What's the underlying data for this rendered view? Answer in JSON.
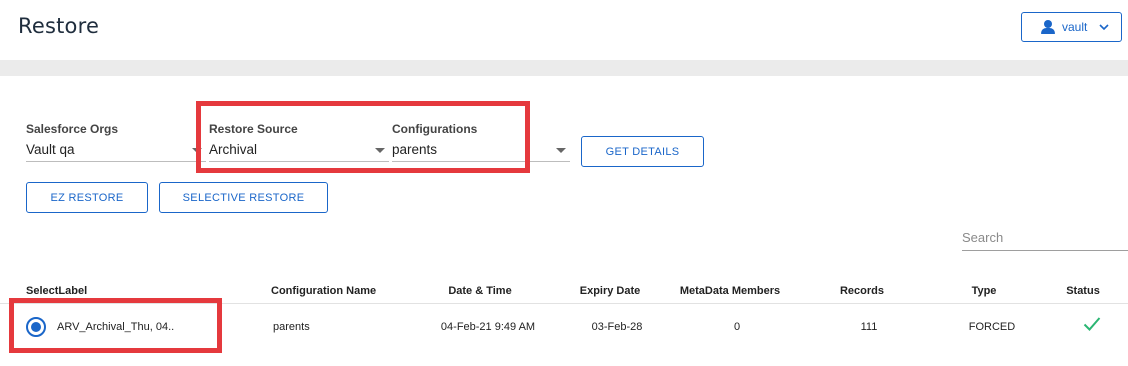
{
  "header": {
    "title": "Restore",
    "user_label": "vault"
  },
  "filters": {
    "orgs": {
      "label": "Salesforce Orgs",
      "value": "Vault qa"
    },
    "source": {
      "label": "Restore Source",
      "value": "Archival"
    },
    "config": {
      "label": "Configurations",
      "value": "parents"
    }
  },
  "buttons": {
    "get_details": "GET DETAILS",
    "ez_restore": "EZ RESTORE",
    "selective_restore": "SELECTIVE RESTORE"
  },
  "search": {
    "placeholder": "Search"
  },
  "table": {
    "columns": [
      "SelectLabel",
      "Configuration Name",
      "Date & Time",
      "Expiry Date",
      "MetaData Members",
      "Records",
      "Type",
      "Status"
    ],
    "rows": [
      {
        "label": "ARV_Archival_Thu, 04..",
        "configuration": "parents",
        "datetime": "04-Feb-21 9:49 AM",
        "expiry": "03-Feb-28",
        "metadata_members": "0",
        "records": "111",
        "type": "FORCED",
        "status_icon": "check-icon",
        "selected": true
      }
    ]
  },
  "colors": {
    "accent": "#1a66c9",
    "highlight": "#e5393d",
    "success": "#2bb673"
  }
}
